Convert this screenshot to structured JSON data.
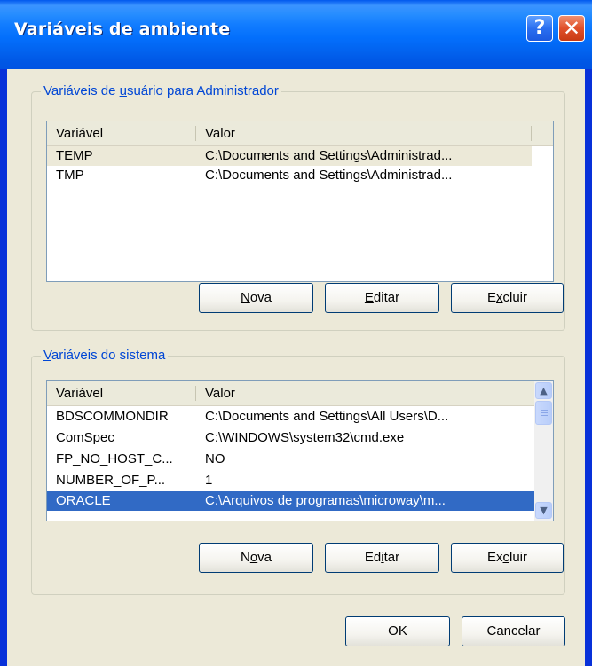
{
  "window": {
    "title": "Variáveis de ambiente",
    "help_glyph": "?",
    "close_glyph": "✕"
  },
  "user_group": {
    "legend_pre": "Variáveis de ",
    "legend_accel": "u",
    "legend_post": "suário para Administrador",
    "columns": [
      "Variável",
      "Valor"
    ],
    "rows": [
      {
        "name": "TEMP",
        "value": "C:\\Documents and Settings\\Administrad..."
      },
      {
        "name": "TMP",
        "value": "C:\\Documents and Settings\\Administrad..."
      }
    ],
    "buttons": {
      "new": {
        "pre": "",
        "accel": "N",
        "post": "ova"
      },
      "edit": {
        "pre": "",
        "accel": "E",
        "post": "ditar"
      },
      "delete": {
        "pre": "E",
        "accel": "x",
        "post": "cluir"
      }
    }
  },
  "system_group": {
    "legend_pre": "",
    "legend_accel": "V",
    "legend_post": "ariáveis do sistema",
    "columns": [
      "Variável",
      "Valor"
    ],
    "rows": [
      {
        "name": "BDSCOMMONDIR",
        "value": "C:\\Documents and Settings\\All Users\\D..."
      },
      {
        "name": "ComSpec",
        "value": "C:\\WINDOWS\\system32\\cmd.exe"
      },
      {
        "name": "FP_NO_HOST_C...",
        "value": "NO"
      },
      {
        "name": "NUMBER_OF_P...",
        "value": "1"
      },
      {
        "name": "ORACLE",
        "value": "C:\\Arquivos de programas\\microway\\m..."
      }
    ],
    "selected_row": "ORACLE",
    "buttons": {
      "new": {
        "pre": "N",
        "accel": "o",
        "post": "va"
      },
      "edit": {
        "pre": "Ed",
        "accel": "i",
        "post": "tar"
      },
      "delete": {
        "pre": "Ex",
        "accel": "c",
        "post": "luir"
      }
    }
  },
  "footer": {
    "ok": "OK",
    "cancel": "Cancelar"
  },
  "colors": {
    "selection": "#316ac5",
    "group_legend": "#0046d5",
    "dialog_face": "#ece9d8",
    "titlebar": "#0054e3"
  }
}
